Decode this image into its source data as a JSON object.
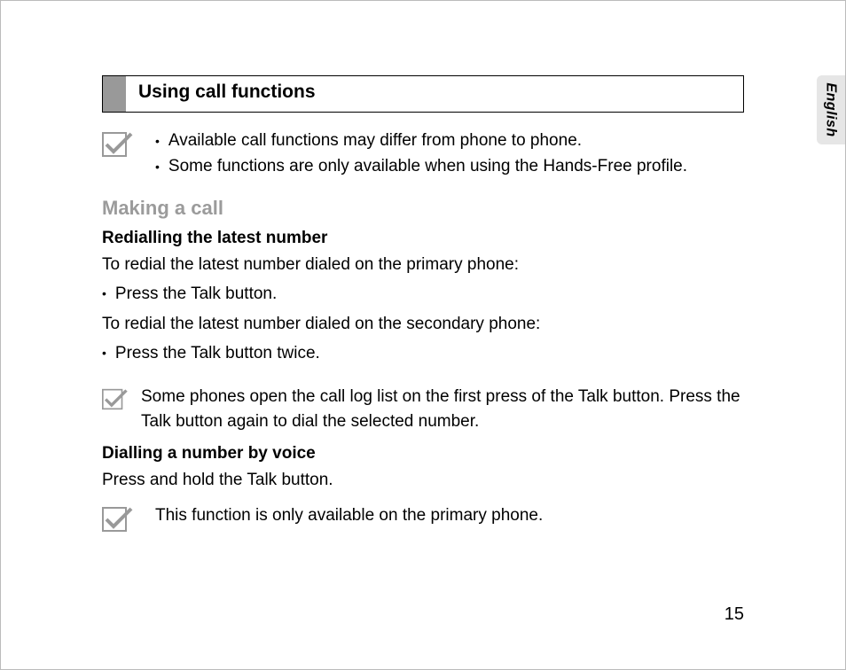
{
  "language_tab": "English",
  "page_number": "15",
  "section_title": "Using call functions",
  "top_note": {
    "bullets": [
      "Available call functions may differ from phone to phone.",
      "Some functions are only available when using the Hands-Free profile."
    ]
  },
  "making_a_call": {
    "heading": "Making a call",
    "redial": {
      "heading": "Redialling the latest number",
      "intro1": "To redial the latest number dialed on the primary phone:",
      "bullet1": "Press the Talk button.",
      "intro2": "To redial the latest number dialed on the secondary phone:",
      "bullet2": "Press the Talk button twice.",
      "note": "Some phones open the call log list on the first press of the Talk button. Press the Talk button again to dial the selected number."
    },
    "voice": {
      "heading": "Dialling a number by voice",
      "intro": "Press and hold the Talk button.",
      "note": "This function is only available on the primary phone."
    }
  }
}
